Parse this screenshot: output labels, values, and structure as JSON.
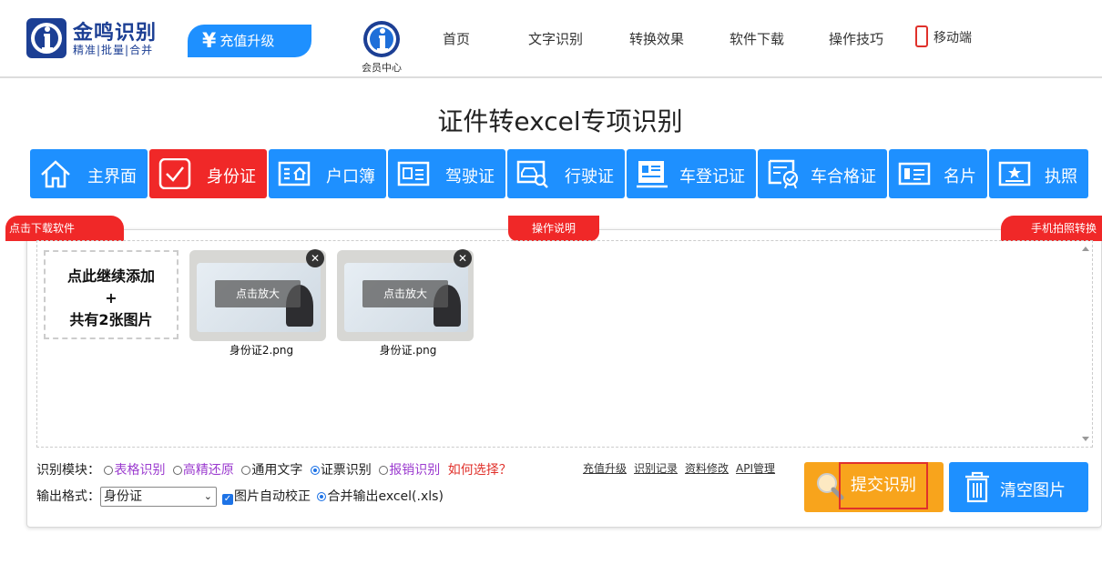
{
  "header": {
    "logo_name": "金鸣识别",
    "logo_slogan": "精准|批量|合并",
    "recharge_label": "充值升级",
    "member_label": "会员中心",
    "nav": [
      "首页",
      "文字识别",
      "转换效果",
      "软件下载",
      "操作技巧"
    ],
    "mobile_label": "移动端"
  },
  "page_title": "证件转excel专项识别",
  "tabs": [
    "主界面",
    "身份证",
    "户口簿",
    "驾驶证",
    "行驶证",
    "车登记证",
    "车合格证",
    "名片",
    "执照"
  ],
  "active_tab": "身份证",
  "panel": {
    "tag_left": "点击下载软件",
    "tag_mid": "操作说明",
    "tag_right": "手机拍照转换",
    "add_line1": "点此继续添加",
    "add_line2": "+",
    "add_line3": "共有2张图片",
    "zoom_label": "点击放大",
    "files": [
      "身份证2.png",
      "身份证.png"
    ]
  },
  "options": {
    "module_label": "识别模块：",
    "modules": [
      "表格识别",
      "高精还原",
      "通用文字",
      "证票识别",
      "报销识别"
    ],
    "selected_module": "证票识别",
    "help_link": "如何选择？",
    "links": [
      "充值升级",
      "识别记录",
      "资料修改",
      "API管理"
    ],
    "format_label": "输出格式：",
    "format_value": "身份证",
    "auto_correct": "图片自动校正",
    "merge_output": "合并输出excel(.xls)"
  },
  "buttons": {
    "submit": "提交识别",
    "clear": "清空图片"
  },
  "colors": {
    "blue": "#1e90ff",
    "red": "#f02828",
    "orange": "#f8a41c",
    "logo_blue": "#1c3f94"
  }
}
